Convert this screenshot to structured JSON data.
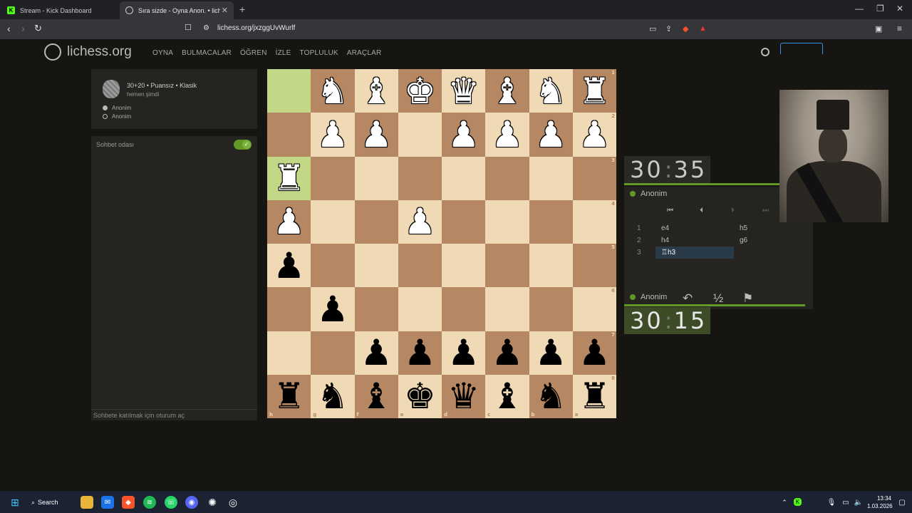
{
  "browser": {
    "tabs": [
      {
        "title": "Stream - Kick Dashboard",
        "active": false
      },
      {
        "title": "Sıra sizde - Oyna Anon. • lich",
        "active": true
      }
    ],
    "url": "lichess.org/jxzggUvWurlf"
  },
  "site": {
    "logo": "lichess.org",
    "nav": [
      "OYNA",
      "BULMACALAR",
      "ÖĞREN",
      "İZLE",
      "TOPLULUK",
      "ARAÇLAR"
    ]
  },
  "game": {
    "title": "30+20 • Puansız • Klasik",
    "time": "hemen şimdi",
    "players": [
      "Anonim",
      "Anonim"
    ]
  },
  "chat": {
    "label": "Sohbet odası",
    "join": "Sohbete katılmak için oturum aç"
  },
  "board": {
    "orientation": "black",
    "files_bottom": [
      "h",
      "g",
      "f",
      "e",
      "d",
      "c",
      "b",
      "a"
    ],
    "ranks_right": [
      "1",
      "2",
      "3",
      "4",
      "5",
      "6",
      "7",
      "8"
    ],
    "rows": [
      [
        "",
        "♞",
        "♝",
        "♚",
        "♛",
        "♝",
        "♞",
        "♜"
      ],
      [
        "",
        "♟",
        "♟",
        "",
        "♟",
        "♟",
        "♟",
        "♟"
      ],
      [
        "♜",
        "",
        "",
        "",
        "",
        "",
        "",
        ""
      ],
      [
        "♟",
        "",
        "",
        "♟",
        "",
        "",
        "",
        ""
      ],
      [
        "♟",
        "",
        "",
        "",
        "",
        "",
        "",
        ""
      ],
      [
        "",
        "♟",
        "",
        "",
        "",
        "",
        "",
        ""
      ],
      [
        "",
        "",
        "♟",
        "♟",
        "♟",
        "♟",
        "♟",
        "♟"
      ],
      [
        "♜",
        "♞",
        "♝",
        "♚",
        "♛",
        "♝",
        "♞",
        "♜"
      ]
    ],
    "white_rows": [
      0,
      1,
      2,
      3
    ],
    "last_move_squares": [
      "h1",
      "h3"
    ]
  },
  "clocks": {
    "top": {
      "min": "30",
      "sec": "35"
    },
    "bottom": {
      "min": "30",
      "sec": "15"
    }
  },
  "players": {
    "top": "Anonim",
    "bottom": "Anonim"
  },
  "moves": [
    {
      "n": "1",
      "w": "e4",
      "b": "h5"
    },
    {
      "n": "2",
      "w": "h4",
      "b": "g6"
    },
    {
      "n": "3",
      "w": "♖h3",
      "b": ""
    }
  ],
  "taskbar": {
    "search": "Search",
    "time": "13:34",
    "date": "1.03.2026"
  },
  "colors": {
    "accent": "#629924",
    "board_light": "#f0d9b5",
    "board_dark": "#b58863"
  }
}
